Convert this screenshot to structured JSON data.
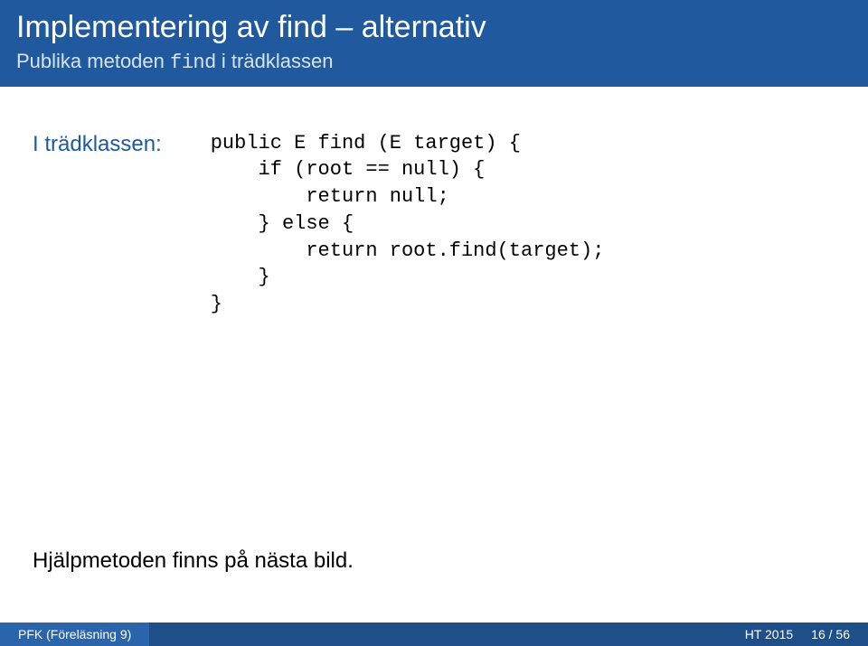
{
  "header": {
    "title": "Implementering av find – alternativ",
    "subtitle_pre": "Publika metoden ",
    "subtitle_code": "find",
    "subtitle_post": " i trädklassen"
  },
  "body": {
    "label": "I trädklassen:",
    "code": "public E find (E target) {\n    if (root == null) {\n        return null;\n    } else {\n        return root.find(target);\n    }\n}",
    "note": "Hjälpmetoden finns på nästa bild."
  },
  "footer": {
    "left": "PFK (Föreläsning 9)",
    "term": "HT 2015",
    "page": "16 / 56"
  }
}
